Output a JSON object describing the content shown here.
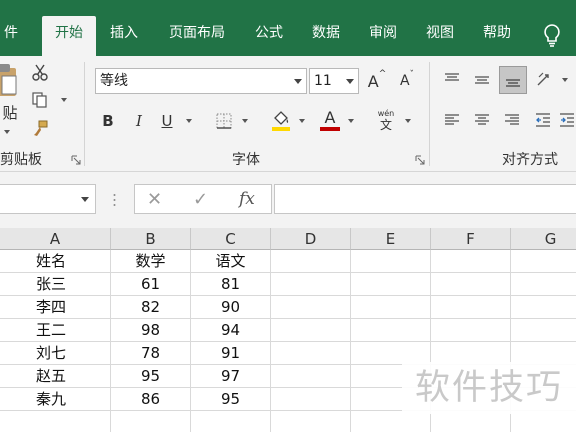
{
  "tabs": [
    {
      "label": "件"
    },
    {
      "label": "开始"
    },
    {
      "label": "插入"
    },
    {
      "label": "页面布局"
    },
    {
      "label": "公式"
    },
    {
      "label": "数据"
    },
    {
      "label": "审阅"
    },
    {
      "label": "视图"
    },
    {
      "label": "帮助"
    }
  ],
  "active_tab": "开始",
  "ribbon": {
    "clipboard": {
      "paste_label": "贴",
      "group_label": "剪贴板"
    },
    "font": {
      "font_name": "等线",
      "font_size": "11",
      "grow_label": "A",
      "shrink_label": "A",
      "bold": "B",
      "italic": "I",
      "underline": "U",
      "font_color_label": "A",
      "phonetic_top": "wén",
      "phonetic_bottom": "文",
      "group_label": "字体"
    },
    "alignment": {
      "group_label": "对齐方式"
    }
  },
  "colors": {
    "brand": "#217346",
    "fill_color": "#ffd800",
    "font_color": "#c00000"
  },
  "formula_bar": {
    "name_box": "",
    "cancel_glyph": "✕",
    "enter_glyph": "✓",
    "fx_label": "fx",
    "content": ""
  },
  "columns": [
    "A",
    "B",
    "C",
    "D",
    "E",
    "F",
    "G"
  ],
  "table": {
    "headers": [
      "姓名",
      "数学",
      "语文"
    ],
    "rows": [
      [
        "张三",
        "61",
        "81"
      ],
      [
        "李四",
        "82",
        "90"
      ],
      [
        "王二",
        "98",
        "94"
      ],
      [
        "刘七",
        "78",
        "91"
      ],
      [
        "赵五",
        "95",
        "97"
      ],
      [
        "秦九",
        "86",
        "95"
      ]
    ]
  },
  "watermark": "软件技巧"
}
